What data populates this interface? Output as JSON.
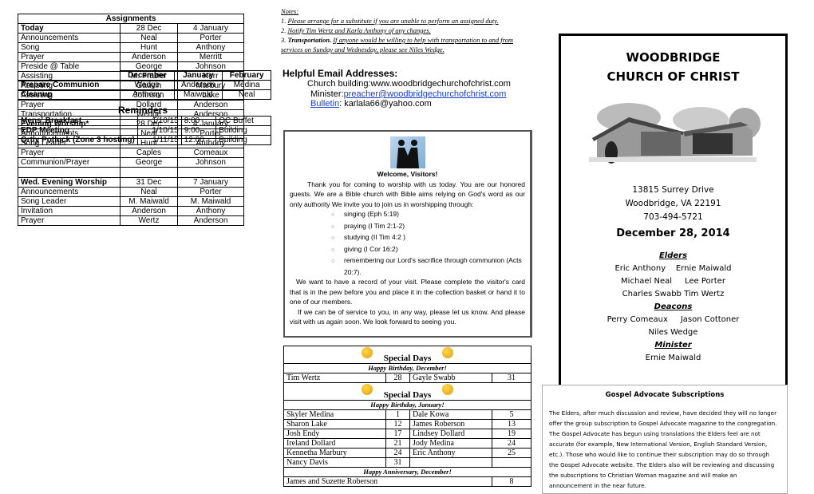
{
  "assignments": {
    "title": "Assignments",
    "rows": [
      {
        "role": "Today",
        "a": "28 Dec",
        "b": "4 January",
        "bold": true
      },
      {
        "role": "Announcements",
        "a": "Neal",
        "b": "Porter"
      },
      {
        "role": "Song",
        "a": "Hunt",
        "b": "Anthony"
      },
      {
        "role": "Prayer",
        "a": "Anderson",
        "b": "Merritt"
      },
      {
        "role": "Preside @ Table",
        "a": "George",
        "b": "Johnson"
      },
      {
        "role": "Assisting",
        "a": "M. Frazier",
        "b": "Kerr"
      },
      {
        "role": "Assisting",
        "a": "Gauvin",
        "b": "Marbury"
      },
      {
        "role": "Assisting",
        "a": "Johnson",
        "b": "Lake"
      },
      {
        "role": "Prayer",
        "a": "Dollard",
        "b": "Anderson"
      },
      {
        "role": "Transportation",
        "a": "Wedge",
        "b": "Anderson"
      },
      {
        "role": "Evening Worship*",
        "a": "28 Dec",
        "b": "4 January",
        "bold": true
      },
      {
        "role": "Announcements",
        "a": "Neal",
        "b": "Porter"
      },
      {
        "role": "Song Leader",
        "a": "Hunt",
        "b": "Anthony"
      },
      {
        "role": "Prayer",
        "a": "Caples",
        "b": "Comeaux"
      },
      {
        "role": "Communion/Prayer",
        "a": "George",
        "b": "Johnson"
      },
      {
        "role": "",
        "a": "",
        "b": "",
        "blank": true
      },
      {
        "role": "Wed. Evening Worship",
        "a": "31 Dec",
        "b": "7 January",
        "bold": true
      },
      {
        "role": "Announcements",
        "a": "Neal",
        "b": "Porter"
      },
      {
        "role": "Song Leader",
        "a": "M. Maiwald",
        "b": "M. Maiwald"
      },
      {
        "role": "Invitation",
        "a": "Anderson",
        "b": "Anthony"
      },
      {
        "role": "Prayer",
        "a": "Wertz",
        "b": "Anderson"
      }
    ]
  },
  "cleanup": {
    "headers": [
      "",
      "December",
      "January",
      "February"
    ],
    "rows": [
      {
        "label": "Prepare Communion",
        "dec": "Wedge",
        "jan": "Anderson",
        "feb": "Medina"
      },
      {
        "label": "Cleanup",
        "dec": "Anthony",
        "jan": "Maiwald",
        "feb": "Neal"
      }
    ]
  },
  "reminders": {
    "title": "Reminders",
    "rows": [
      {
        "event": "Mens' Breakfast",
        "date": "1/10/15",
        "time": "8:00",
        "place": "OC Buffet"
      },
      {
        "event": "EDP Meeting",
        "date": "1/10/15",
        "time": "9:00",
        "place": "Building"
      },
      {
        "event": "Qrtly Potluck (Zone 3 hosting)",
        "date": "1/11/15",
        "time": "12:00",
        "place": "Building"
      }
    ]
  },
  "notes": {
    "title": "Notes:",
    "items": [
      {
        "num": "1.",
        "text": "Please arrange for a substitute if you are unable to perform an assigned duty."
      },
      {
        "num": "2.",
        "text": "Notify Tim Wertz and Karla Anthony of any changes."
      },
      {
        "num": "3.",
        "bold": "Transportation.",
        "text": "If anyone would be willing to help with transportation to and from services on Sunday and Wednesday, please see Niles Wedge."
      }
    ]
  },
  "emails": {
    "title": "Helpful Email Addresses:",
    "church_label": "Church building:",
    "church_value": "www.woodbridgechurchofchrist.com",
    "minister_label": "Minister:",
    "minister_value": "preacher@woodbridgechurchofchrist.com",
    "bulletin_label": "Bulletin",
    "bulletin_value": ":  karlala66@yahoo.com"
  },
  "welcome": {
    "title": "Welcome, Visitors!",
    "intro": "Thank you for coming to worship with us today.  You are our honored guests.  We are a Bible church with Bible aims relying on God's word as our only authority  We invite you to join us in worshipping through:",
    "items": [
      "singing (Eph 5:19)",
      "praying (I Tim 2:1-2)",
      "studying (II Tim 4:2 )",
      "giving (I Cor 16:2)",
      "remembering our Lord's sacrifice through communion (Acts 20:7)."
    ],
    "para2": "We want to have a record of your visit.  Please complete the visitor's card that is in the pew before you and place it in the collection basket or hand it to one of our members.",
    "para3": "If we can be of service to you, in any way, please let us know. And please visit with us again soon.  We look forward to seeing you."
  },
  "special_days": {
    "title": "Special Days",
    "december_label": "Happy Birthday, December!",
    "december": [
      {
        "n1": "Tim Wertz",
        "d1": "28",
        "n2": "Gayle Swabb",
        "d2": "31"
      }
    ],
    "january_label": "Happy Birthday, January!",
    "january": [
      {
        "n1": "Skyler Medina",
        "d1": "1",
        "n2": "Dale Kowa",
        "d2": "5"
      },
      {
        "n1": "Sharon Lake",
        "d1": "12",
        "n2": "James Roberson",
        "d2": "13"
      },
      {
        "n1": "Josh Endy",
        "d1": "17",
        "n2": "Lindsey Dollard",
        "d2": "19"
      },
      {
        "n1": "Ireland Dollard",
        "d1": "21",
        "n2": "Jody Medina",
        "d2": "24"
      },
      {
        "n1": "Kennetha Marbury",
        "d1": "24",
        "n2": "Eric Anthony",
        "d2": "25"
      },
      {
        "n1": "Nancy Davis",
        "d1": "31",
        "n2": "",
        "d2": ""
      }
    ],
    "anniversary_label": "Happy Anniversary, December!",
    "anniversary": {
      "names": "James and Suzette Roberson",
      "day": "8"
    }
  },
  "church": {
    "name_line1": "WOODBRIDGE",
    "name_line2": "CHURCH OF CHRIST",
    "address1": "13815 Surrey Drive",
    "address2": "Woodbridge, VA 22191",
    "phone": "703-494-5721",
    "date": "December 28, 2014",
    "elders_label": "Elders",
    "elders": [
      "Eric Anthony    Ernie Maiwald",
      "Michael Neal     Lee Porter",
      "Charles Swabb Tim Wertz"
    ],
    "deacons_label": "Deacons",
    "deacons": [
      "Perry Comeaux     Jason Cottoner",
      "Niles Wedge"
    ],
    "minister_label": "Minister",
    "minister": "Ernie Maiwald"
  },
  "gospel": {
    "title": "Gospel Advocate Subscriptions",
    "body": "The Elders, after much discussion and review, have decided they will no longer offer the group subscription to Gospel Advocate magazine to the congregation. The Gospel Advocate has begun using translations the Elders feel are not accurate (for example, New International Version, English Standard Version, etc.).  Those who would like to continue their subscription may do so through the Gospel Advocate website.  The Elders also will be reviewing and discussing the subscriptions to Christian Woman magazine and will make an announcement in the near future."
  }
}
